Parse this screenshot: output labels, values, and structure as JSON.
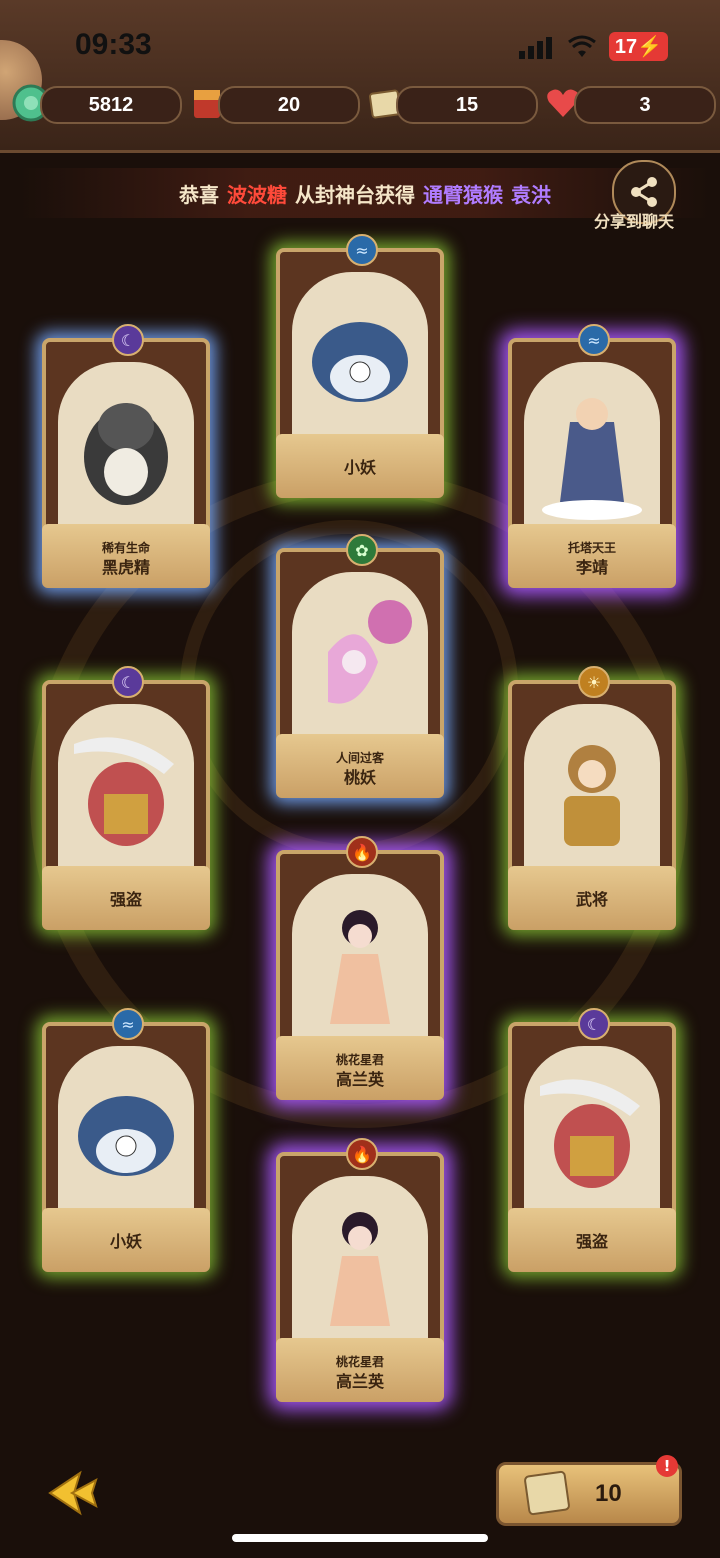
{
  "status": {
    "time": "09:33",
    "battery": "17"
  },
  "resources": [
    {
      "icon": "jade-coin-icon",
      "value": "5812"
    },
    {
      "icon": "red-envelope-icon",
      "value": "20"
    },
    {
      "icon": "ticket-icon",
      "value": "15"
    },
    {
      "icon": "heart-icon",
      "value": "3"
    }
  ],
  "banner": {
    "prefix": "恭喜",
    "player": "波波糖",
    "middle": "从封神台获得",
    "title": "通臂猿猴",
    "hero": "袁洪"
  },
  "share": {
    "label": "分享到聊天"
  },
  "cards": [
    {
      "sub": "",
      "name": "小妖",
      "element": "water",
      "glow": "green"
    },
    {
      "sub": "稀有生命",
      "name": "黑虎精",
      "element": "moon",
      "glow": "blue"
    },
    {
      "sub": "托塔天王",
      "name": "李靖",
      "element": "water",
      "glow": "purple"
    },
    {
      "sub": "人间过客",
      "name": "桃妖",
      "element": "wood",
      "glow": "blue"
    },
    {
      "sub": "",
      "name": "强盗",
      "element": "moon",
      "glow": "green"
    },
    {
      "sub": "",
      "name": "武将",
      "element": "sun",
      "glow": "green"
    },
    {
      "sub": "桃花星君",
      "name": "高兰英",
      "element": "fire",
      "glow": "purple"
    },
    {
      "sub": "",
      "name": "小妖",
      "element": "water",
      "glow": "green"
    },
    {
      "sub": "",
      "name": "强盗",
      "element": "moon",
      "glow": "green"
    },
    {
      "sub": "桃花星君",
      "name": "高兰英",
      "element": "fire",
      "glow": "purple"
    }
  ],
  "draw": {
    "ticket_char": "劵",
    "count": "10",
    "badge": "!"
  },
  "colors": {
    "player": "#ff4a3a",
    "hero_title": "#b07cff",
    "text": "#f5e6c8"
  }
}
